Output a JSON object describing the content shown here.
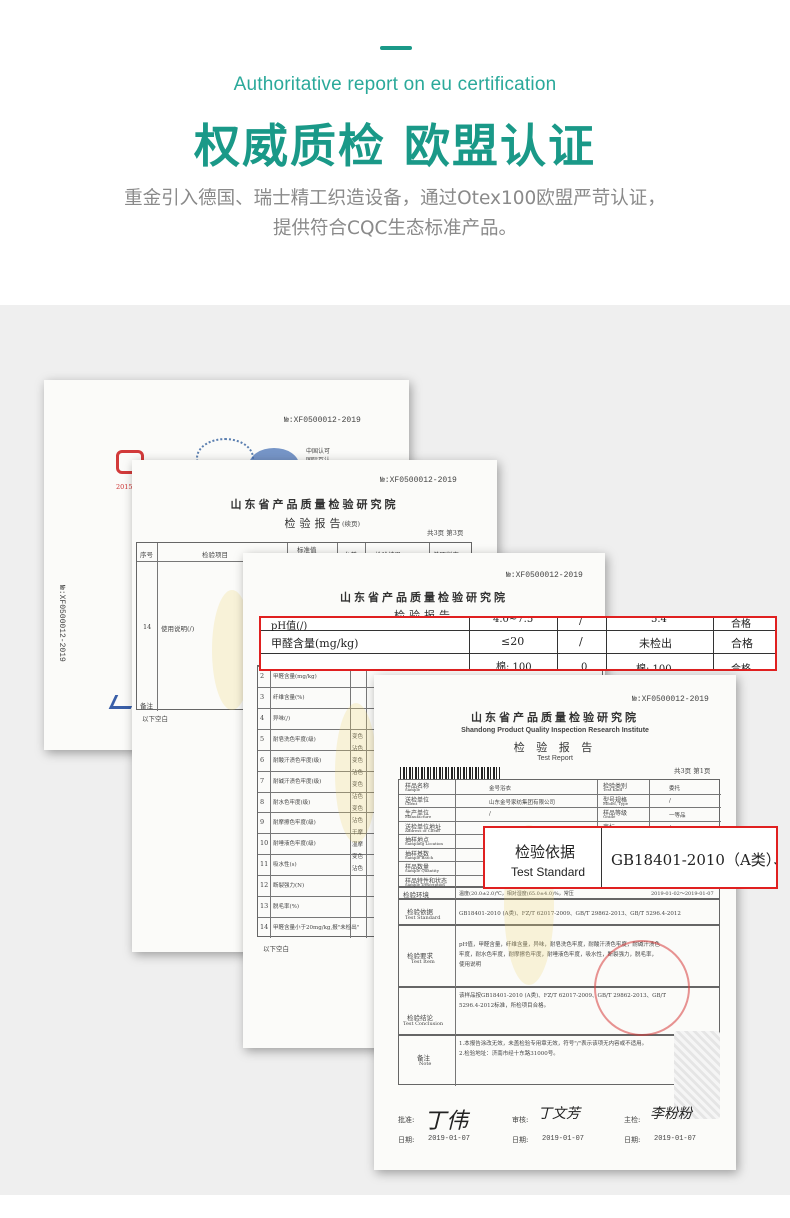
{
  "header": {
    "subtitle_en": "Authoritative report on eu certification",
    "title_cn": "权威质检 欧盟认证",
    "desc_line1": "重金引入德国、瑞士精工织造设备，通过Otex100欧盟严苛认证，",
    "desc_line2": "提供符合CQC生态标准产品。"
  },
  "colors": {
    "accent": "#1a9988",
    "callout_border": "#e02020",
    "stage_bg": "#efefef"
  },
  "docs": {
    "doc1": {
      "report_no": "№:XF0500012-2019",
      "side_no": "№:XF0500012-2019",
      "year": "2015",
      "cert_text": "中国认可\n国际互认"
    },
    "doc2": {
      "report_no": "№:XF0500012-2019",
      "institute": "山东省产品质量检验研究院",
      "report_title": "检验报告",
      "cont": "(续页)",
      "page": "共3页 第3页",
      "headers": [
        "序号",
        "检验项目",
        "标准值\n(一等品)",
        "允差",
        "检验结果",
        "单项判定"
      ],
      "row_no": "14",
      "row_item": "使用说明(/)",
      "blank": "以下空白",
      "remark": "备注"
    },
    "doc3": {
      "report_no": "№:XF0500012-2019",
      "institute": "山东省产品质量检验研究院",
      "report_title": "检验报告",
      "cont": "(续页)",
      "rows": [
        {
          "no": "2",
          "item": "甲醛含量(mg/kg)"
        },
        {
          "no": "3",
          "item": "纤维含量(%)"
        },
        {
          "no": "4",
          "item": "异味(/)"
        },
        {
          "no": "5",
          "item": "耐皂洗色牢度(级)"
        },
        {
          "no": "6",
          "item": "耐酸汗渍色牢度(级)"
        },
        {
          "no": "7",
          "item": "耐碱汗渍色牢度(级)"
        },
        {
          "no": "8",
          "item": "耐水色牢度(级)"
        },
        {
          "no": "9",
          "item": "耐摩擦色牢度(级)"
        },
        {
          "no": "10",
          "item": "耐唾液色牢度(级)"
        },
        {
          "no": "11",
          "item": "吸水性(s)"
        },
        {
          "no": "12",
          "item": "断裂强力(N)"
        },
        {
          "no": "13",
          "item": "脱毛率(%)"
        },
        {
          "no": "14",
          "item": "甲醛含量小于20mg/kg,报\"未检出\""
        }
      ],
      "shade_labels": [
        "变色",
        "沾色",
        "变色",
        "沾色",
        "变色",
        "沾色",
        "变色",
        "沾色",
        "干摩",
        "湿摩",
        "变色",
        "沾色"
      ],
      "blank": "以下空白"
    },
    "doc4": {
      "report_no": "№:XF0500012-2019",
      "institute": "山东省产品质量检验研究院",
      "institute_en": "Shandong Product Quality Inspection Research Institute",
      "report_title": "检 验 报 告",
      "report_title_en": "Test Report",
      "page": "共3页 第1页",
      "fields": [
        {
          "cn": "样品名称",
          "en": "Sample",
          "value": "金号浴衣"
        },
        {
          "cn": "送检单位",
          "en": "Client",
          "value": "山东金号家纺集团有限公司"
        },
        {
          "cn": "生产单位",
          "en": "Manufacture",
          "value": "/"
        },
        {
          "cn": "送检单位地址",
          "en": "Address of Client",
          "value": ""
        },
        {
          "cn": "抽样地点",
          "en": "Sampling Location",
          "value": ""
        },
        {
          "cn": "抽样基数",
          "en": "Sample Batch",
          "value": ""
        },
        {
          "cn": "样品数量",
          "en": "Sample Quantity",
          "value": "1件+400cm×幅宽一块"
        },
        {
          "cn": "样品特性和状态",
          "en": "Sample Description",
          "value": "非制绒"
        },
        {
          "cn": "检验环境",
          "en": "Environmental for Test",
          "value": "温度(20.0±2.0)℃，相对湿度(65.0±4.0)%，常压"
        }
      ],
      "right_fields": [
        {
          "cn": "检验类别",
          "en": "Test Kind",
          "value": "委托"
        },
        {
          "cn": "型号规格",
          "en": "Model, Type",
          "value": "/"
        },
        {
          "cn": "样品等级",
          "en": "Grade",
          "value": "一等品"
        },
        {
          "cn": "商标",
          "en": "",
          "value": "/"
        },
        {
          "cn": "生产日期",
          "en": "Producing Date",
          "value": "/"
        },
        {
          "cn": "批号",
          "en": "Batch No.",
          "value": "/"
        },
        {
          "cn": "检验日期",
          "en": "Test Date",
          "value": "2019-01-02～2019-01-07"
        }
      ],
      "basis": {
        "cn": "检验依据",
        "en": "Test Standard",
        "value": "GB18401-2010 (A类)、FZ/T 62017-2009、GB/T 29862-2013、GB/T 5296.4-2012"
      },
      "items": {
        "cn": "检验要求",
        "en": "Test Item",
        "value1": "pH值，甲醛含量，纤维含量，异味，耐皂洗色牢度，耐酸汗渍色牢度，耐碱汗渍色",
        "value2": "牢度，耐水色牢度，耐摩擦色牢度，耐唾液色牢度，吸水性，断裂强力，脱毛率，",
        "value3": "使用说明"
      },
      "conclusion": {
        "cn": "检验结论",
        "en": "Test Conclusion",
        "value1": "该样品按GB18401-2010 (A类)、FZ/T 62017-2009、GB/T 29862-2013、GB/T",
        "value2": "5296.4-2012标准，所检项目合格。"
      },
      "note": {
        "cn": "备注",
        "en": "Note",
        "value1": "1.本报告涂改无效，未盖检验专用章无效，符号\"/\"表示该项无内容或不适用。",
        "value2": "2.检验地址：济南市经十东路31000号。"
      },
      "signatures": [
        {
          "role": "批准:",
          "name": "丁伟",
          "date_label": "日期:",
          "date": "2019-01-07"
        },
        {
          "role": "审核:",
          "name": "丁文芳",
          "date_label": "日期:",
          "date": "2019-01-07"
        },
        {
          "role": "主检:",
          "name": "李粉粉",
          "date_label": "日期:",
          "date": "2019-01-07"
        }
      ]
    }
  },
  "callout_top": {
    "row1_item": "pH值(/)",
    "row1_std": "4.0~7.5",
    "row1_tol": "/",
    "row1_res": "5.4",
    "row1_judge": "合格",
    "row2_item": "甲醛含量(mg/kg)",
    "row2_std": "≤20",
    "row2_tol": "/",
    "row2_res": "未检出",
    "row2_judge": "合格",
    "row3_std": "棉: 100",
    "row3_tol": "0",
    "row3_res": "棉: 100",
    "row3_judge": "合格"
  },
  "callout_bottom": {
    "label_cn": "检验依据",
    "label_en": "Test Standard",
    "value": "GB18401-2010（A类）、"
  }
}
